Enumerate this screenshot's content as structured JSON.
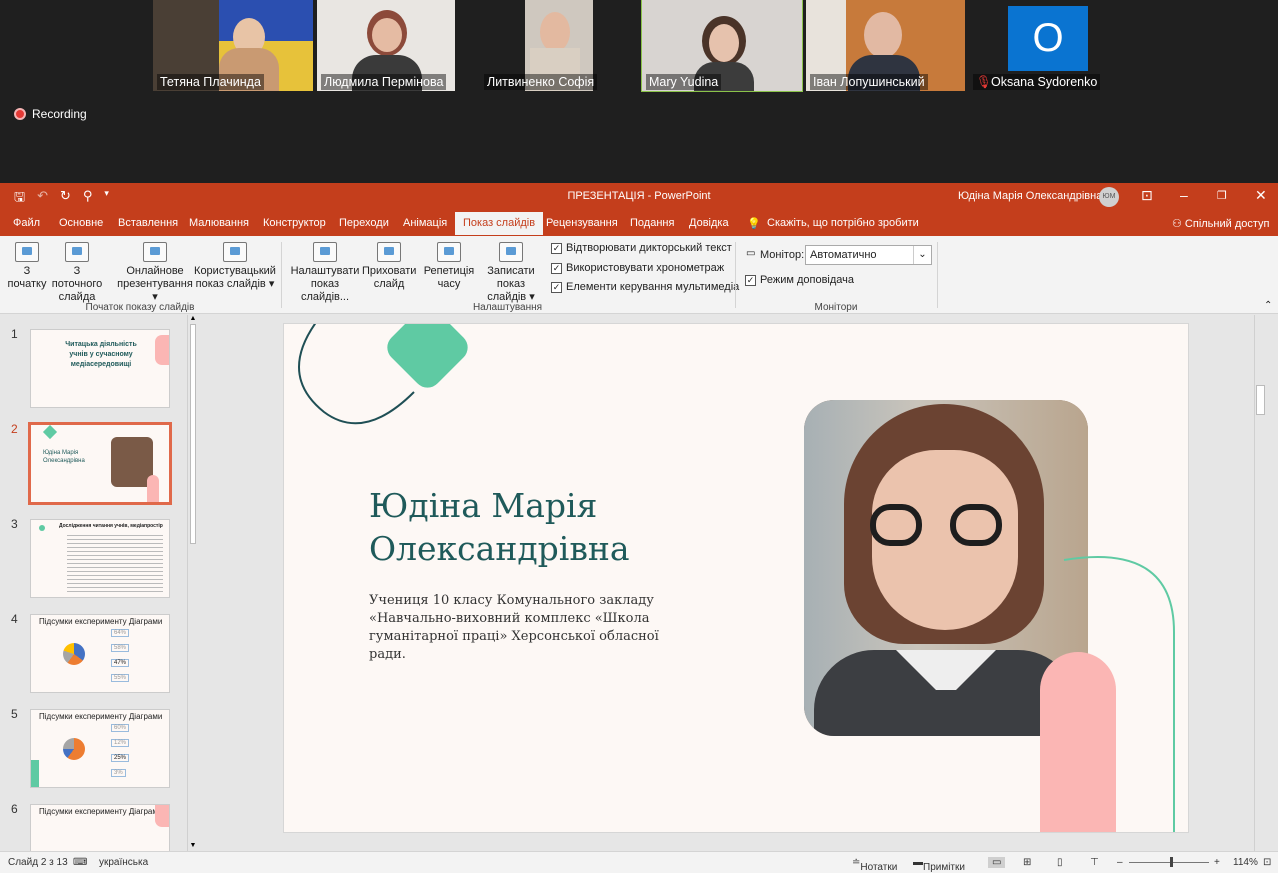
{
  "meeting": {
    "participants": [
      {
        "name": "Тетяна Плачинда"
      },
      {
        "name": "Людмила Пермінова"
      },
      {
        "name": "Литвиненко Софія"
      },
      {
        "name": "Mary Yudina"
      },
      {
        "name": "Іван Лопушинський"
      },
      {
        "name": "Oksana Sydorenko",
        "initial": "O"
      }
    ],
    "recording_label": "Recording"
  },
  "titlebar": {
    "title": "ПРЕЗЕНТАЦІЯ  -  PowerPoint",
    "user": "Юдіна Марія Олександрівна",
    "avatar": "ЮМ"
  },
  "menu": {
    "tabs": [
      "Файл",
      "Основне",
      "Вставлення",
      "Малювання",
      "Конструктор",
      "Переходи",
      "Анімація",
      "Показ слайдів",
      "Рецензування",
      "Подання",
      "Довідка"
    ],
    "search": "Скажіть, що потрібно зробити",
    "share": "Спільний доступ"
  },
  "ribbon": {
    "btn_from_start": [
      "З",
      "початку"
    ],
    "btn_from_current": [
      "З поточного",
      "слайда"
    ],
    "btn_online": [
      "Онлайнове",
      "презентування"
    ],
    "btn_custom": [
      "Користувацький",
      "показ слайдів"
    ],
    "group1": "Початок показу слайдів",
    "btn_setup": [
      "Налаштувати",
      "показ слайдів..."
    ],
    "btn_hide": [
      "Приховати",
      "слайд"
    ],
    "btn_rehearse": [
      "Репетиція",
      "часу"
    ],
    "btn_record": [
      "Записати показ",
      "слайдів"
    ],
    "chk_narration": "Відтворювати дикторський текст",
    "chk_timings": "Використовувати хронометраж",
    "chk_controls": "Елементи керування мультимедіа",
    "group2": "Налаштування",
    "monitor_label": "Монітор:",
    "monitor_value": "Автоматично",
    "presenter_view": "Режим доповідача",
    "group3": "Монітори"
  },
  "thumbnails": [
    {
      "num": "1",
      "title": "Читацька діяльність учнів у сучасному медіасередовищі"
    },
    {
      "num": "2",
      "title": "Юдіна Марія Олександрівна"
    },
    {
      "num": "3",
      "title": "Дослідження читання учнів, медіапростір"
    },
    {
      "num": "4",
      "title": "Підсумки експерименту  Діаграми",
      "vals": [
        "64%",
        "58%",
        "47%",
        "55%"
      ]
    },
    {
      "num": "5",
      "title": "Підсумки експерименту  Діаграми",
      "vals": [
        "60%",
        "12%",
        "25%",
        "3%"
      ]
    },
    {
      "num": "6",
      "title": "Підсумки експерименту  Діаграми"
    }
  ],
  "slide": {
    "name_line1": "Юдіна Марія",
    "name_line2": "Олександрівна",
    "description": "Учениця 10 класу Комунального закладу «Навчально-виховний комплекс «Школа гуманітарної праці» Херсонської обласної ради."
  },
  "status": {
    "slide_info": "Слайд 2 з 13",
    "language": "українська",
    "notes": "Нотатки",
    "comments": "Примітки",
    "zoom": "114%"
  }
}
